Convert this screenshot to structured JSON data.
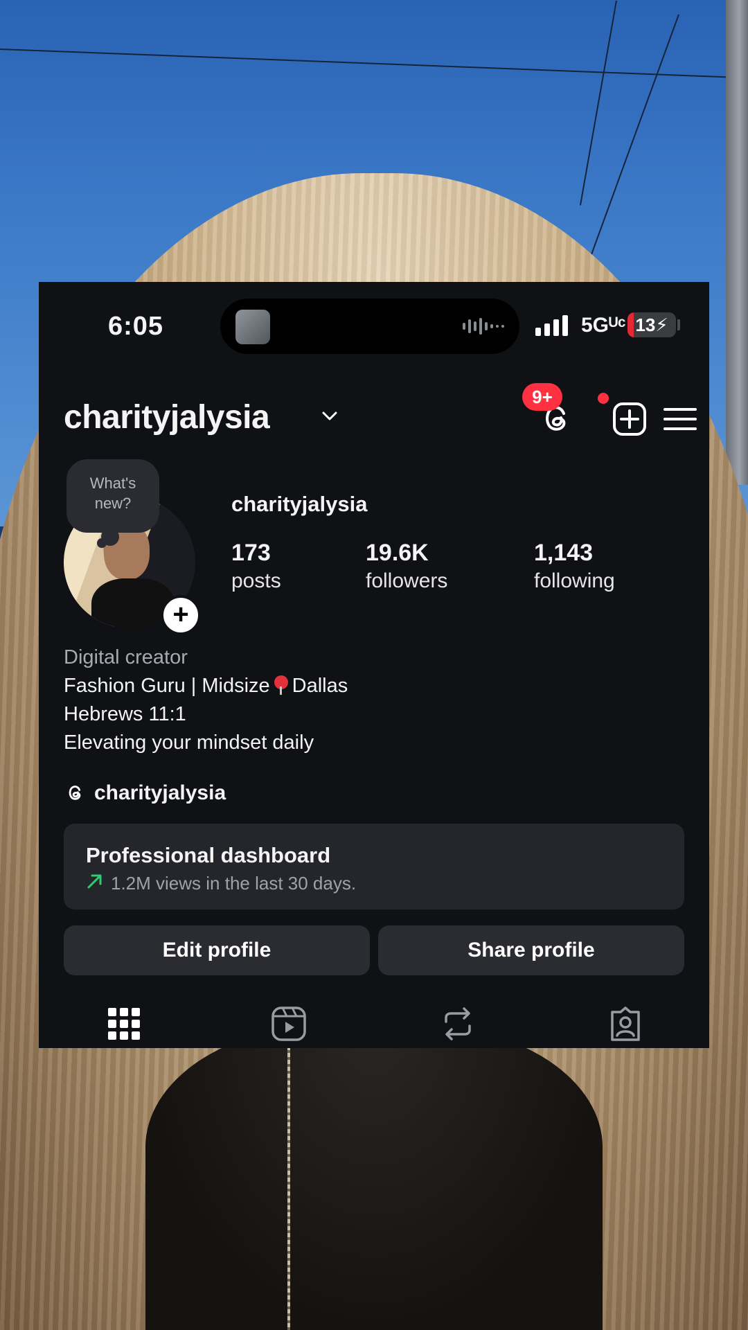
{
  "status_bar": {
    "time": "6:05",
    "network": "5Gᵁᶜ",
    "battery": "13",
    "battery_charging": true,
    "battery_level_percent": 13
  },
  "header": {
    "username": "charityjalysia",
    "threads_badge": "9+",
    "icons": [
      "chevron-down-icon",
      "threads-icon",
      "create-post-icon",
      "menu-icon"
    ]
  },
  "note_bubble": {
    "line1": "What's",
    "line2": "new?"
  },
  "profile": {
    "handle": "charityjalysia",
    "stats": [
      {
        "value": "173",
        "label": "posts"
      },
      {
        "value": "19.6K",
        "label": "followers"
      },
      {
        "value": "1,143",
        "label": "following"
      }
    ]
  },
  "bio": {
    "category": "Digital creator",
    "line1_before_pin": "Fashion Guru | Midsize",
    "line1_after_pin": "Dallas",
    "line2": "Hebrews 11:1",
    "line3": "Elevating your mindset daily"
  },
  "threads_link": {
    "text": "charityjalysia"
  },
  "dashboard": {
    "title": "Professional dashboard",
    "subtitle": "1.2M views in the last 30 days."
  },
  "buttons": {
    "edit": "Edit profile",
    "share": "Share profile"
  },
  "tabs": [
    "grid-icon",
    "reels-icon",
    "reposts-icon",
    "tagged-icon"
  ],
  "colors": {
    "accent_red": "#ff3040",
    "panel_bg": "#0f1115",
    "button_bg": "#2a2c31",
    "trend_green": "#2ecc71"
  }
}
